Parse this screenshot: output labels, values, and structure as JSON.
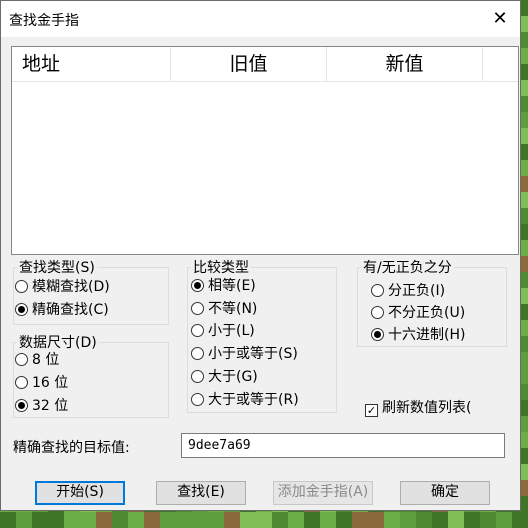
{
  "window": {
    "title": "查找金手指",
    "close_glyph": "✕"
  },
  "list": {
    "columns": [
      "地址",
      "旧值",
      "新值"
    ]
  },
  "search_type": {
    "legend": "查找类型(S)",
    "options": [
      "模糊查找(D)",
      "精确查找(C)"
    ],
    "selected": 1
  },
  "data_size": {
    "legend": "数据尺寸(D)",
    "options": [
      "8 位",
      "16 位",
      "32 位"
    ],
    "selected": 2
  },
  "compare_type": {
    "legend": "比较类型",
    "options": [
      "相等(E)",
      "不等(N)",
      "小于(L)",
      "小于或等于(S)",
      "大于(G)",
      "大于或等于(R)"
    ],
    "selected": 0
  },
  "sign": {
    "legend": "有/无正负之分",
    "options": [
      "分正负(I)",
      "不分正负(U)",
      "十六进制(H)"
    ],
    "selected": 2
  },
  "refresh": {
    "label": "刷新数值列表(",
    "checked": true,
    "check_glyph": "✓"
  },
  "target": {
    "label": "精确查找的目标值:",
    "value": "9dee7a69"
  },
  "buttons": {
    "start": "开始(S)",
    "find": "查找(E)",
    "add_cheat": "添加金手指(A)",
    "ok": "确定"
  }
}
